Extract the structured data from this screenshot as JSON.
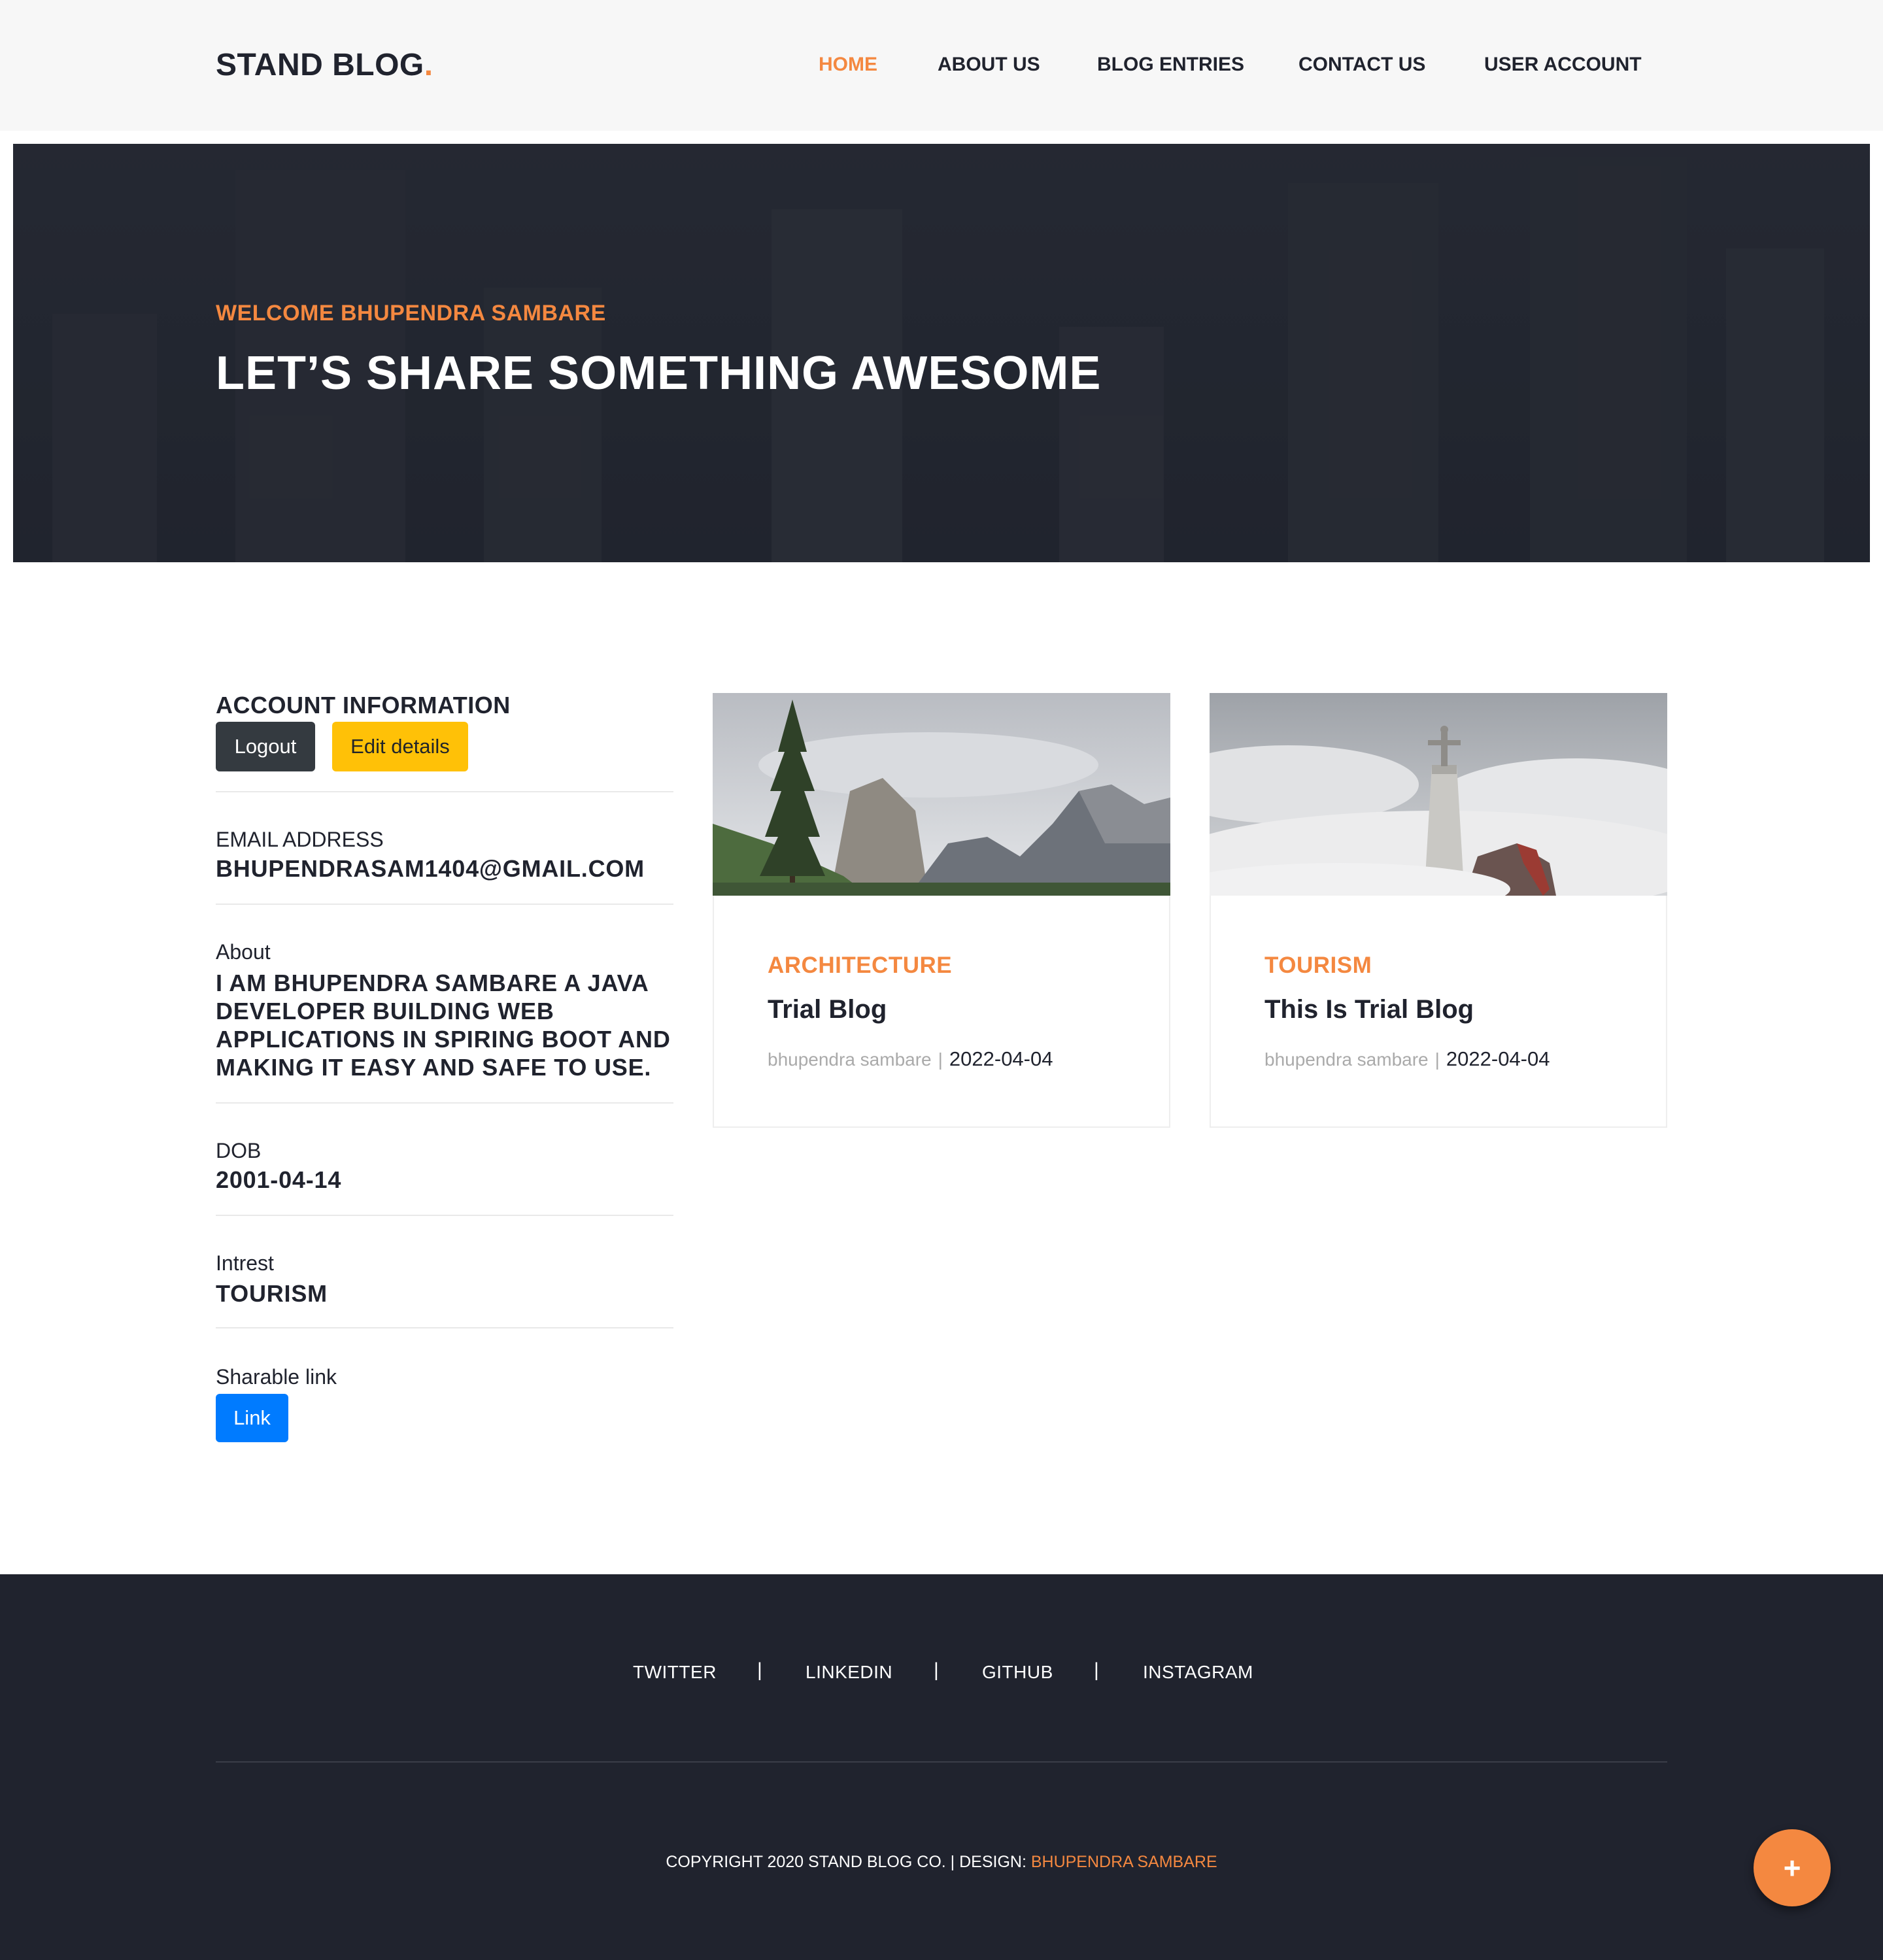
{
  "colors": {
    "accent": "#f48840",
    "dark": "#20232e",
    "header_bg": "#f7f7f7",
    "logout_btn": "#343a40",
    "edit_btn": "#ffc107",
    "link_btn": "#007bff"
  },
  "header": {
    "logo": "STAND BLOG",
    "logo_dot": ".",
    "nav": [
      "HOME",
      "ABOUT US",
      "BLOG ENTRIES",
      "CONTACT US",
      "USER ACCOUNT"
    ],
    "active_nav": "HOME"
  },
  "hero": {
    "subtitle": "WELCOME BHUPENDRA SAMBARE",
    "title": "LET’S SHARE SOMETHING AWESOME"
  },
  "account": {
    "heading": "ACCOUNT INFORMATION",
    "logout_label": "Logout",
    "edit_label": "Edit details",
    "fields": [
      {
        "label": "EMAIL ADDRESS",
        "value": "BHUPENDRASAM1404@GMAIL.COM"
      },
      {
        "label": "About",
        "value": "I AM BHUPENDRA SAMBARE A JAVA DEVELOPER BUILDING WEB APPLICATIONS IN SPIRING BOOT AND MAKING IT EASY AND SAFE TO USE."
      },
      {
        "label": "DOB",
        "value": "2001-04-14"
      },
      {
        "label": "Intrest",
        "value": "TOURISM"
      }
    ],
    "share_label": "Sharable link",
    "link_label": "Link"
  },
  "posts": [
    {
      "category": "ARCHITECTURE",
      "title": "Trial Blog",
      "author": "bhupendra sambare",
      "separator": "|",
      "date": "2022-04-04",
      "image": "mountain-valley-with-pine-tree"
    },
    {
      "category": "TOURISM",
      "title": "This Is Trial Blog",
      "author": "bhupendra sambare",
      "separator": "|",
      "date": "2022-04-04",
      "image": "statue-tower-above-clouds"
    }
  ],
  "footer": {
    "social": [
      "TWITTER",
      "LINKEDIN",
      "GITHUB",
      "INSTAGRAM"
    ],
    "separator": "|",
    "copyright": "COPYRIGHT 2020 STAND BLOG CO. | DESIGN: ",
    "designer": "BHUPENDRA SAMBARE",
    "fab_icon": "plus-icon",
    "fab_glyph": "+"
  }
}
